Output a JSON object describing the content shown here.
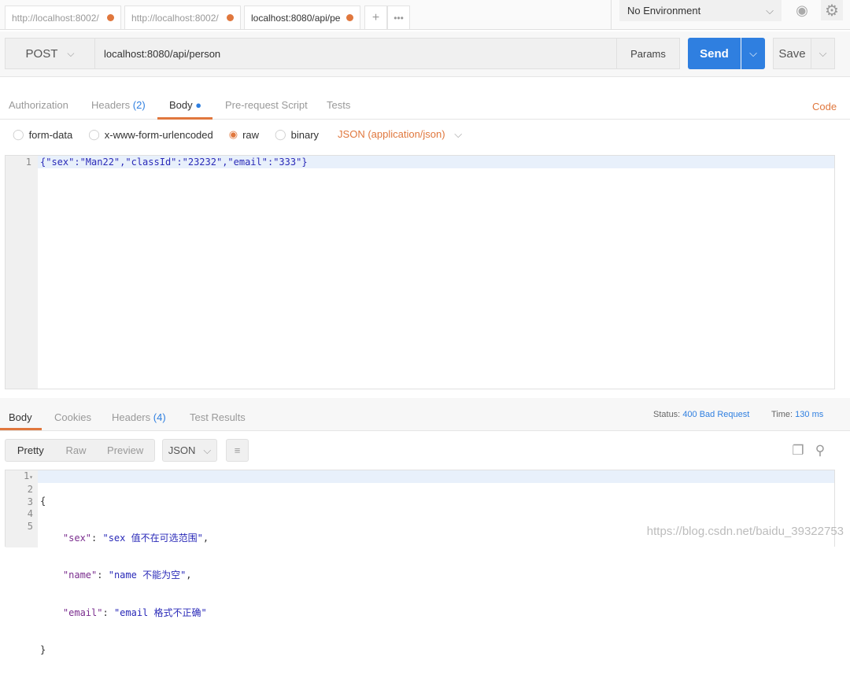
{
  "tabs": [
    {
      "label": "http://localhost:8002/"
    },
    {
      "label": "http://localhost:8002/"
    },
    {
      "label": "localhost:8080/api/pe"
    }
  ],
  "tab_add": "+",
  "tab_more": "•••",
  "environment": "No Environment",
  "request": {
    "method": "POST",
    "url": "localhost:8080/api/person",
    "params": "Params",
    "send": "Send",
    "save": "Save"
  },
  "req_tabs": {
    "auth": "Authorization",
    "headers": "Headers",
    "headers_count": "(2)",
    "body": "Body",
    "prerequest": "Pre-request Script",
    "tests": "Tests",
    "code": "Code"
  },
  "body_types": {
    "form": "form-data",
    "urlenc": "x-www-form-urlencoded",
    "raw": "raw",
    "binary": "binary",
    "content_type": "JSON (application/json)"
  },
  "req_body": {
    "line": "1",
    "text": "{\"sex\":\"Man22\",\"classId\":\"23232\",\"email\":\"333\"}"
  },
  "resp_tabs": {
    "body": "Body",
    "cookies": "Cookies",
    "headers": "Headers",
    "headers_count": "(4)",
    "tests": "Test Results"
  },
  "status": {
    "label": "Status:",
    "value": "400 Bad Request",
    "time_label": "Time:",
    "time": "130 ms"
  },
  "view": {
    "pretty": "Pretty",
    "raw": "Raw",
    "preview": "Preview",
    "format": "JSON"
  },
  "resp_body": {
    "lines": [
      "1",
      "2",
      "3",
      "4",
      "5"
    ],
    "open": "{",
    "close": "}",
    "rows": [
      {
        "key": "\"sex\"",
        "value": "\"sex 值不在可选范围\"",
        "comma": ","
      },
      {
        "key": "\"name\"",
        "value": "\"name 不能为空\"",
        "comma": ","
      },
      {
        "key": "\"email\"",
        "value": "\"email 格式不正确\"",
        "comma": ""
      }
    ]
  },
  "watermark": "https://blog.csdn.net/baidu_39322753",
  "colors": {
    "accent": "#e0773d",
    "send": "#2f7fe0",
    "status": "#2f7fe0"
  }
}
